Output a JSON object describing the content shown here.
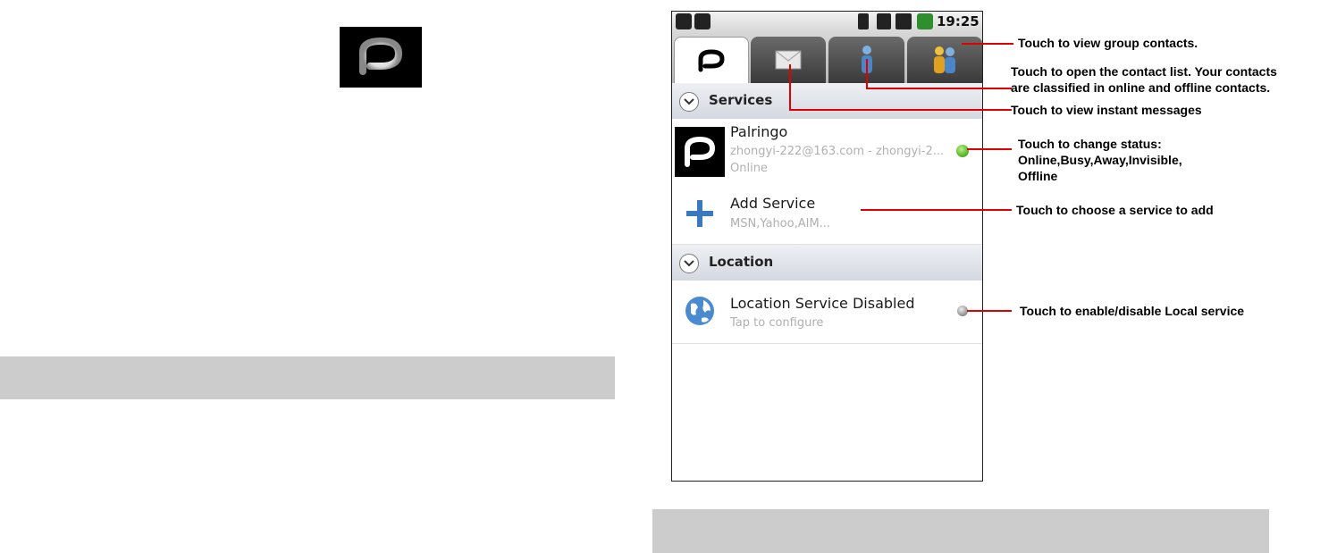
{
  "phone": {
    "status_bar": {
      "time": "19:25"
    },
    "tabs": [
      {
        "icon": "palringo-icon",
        "selected": true
      },
      {
        "icon": "envelope-icon"
      },
      {
        "icon": "person-icon"
      },
      {
        "icon": "group-icon"
      }
    ],
    "sections": {
      "services": {
        "title": "Services",
        "items": [
          {
            "name": "Palringo",
            "detail": "zhongyi-222@163.com - zhongyi-2...",
            "status": "Online",
            "status_color": "#5cb82a"
          },
          {
            "name": "Add Service",
            "detail": "MSN,Yahoo,AIM..."
          }
        ]
      },
      "location": {
        "title": "Location",
        "items": [
          {
            "name": "Location Service Disabled",
            "detail": "Tap to configure",
            "status_color": "#999999"
          }
        ]
      }
    }
  },
  "callouts": {
    "group_contacts": "Touch to view group contacts.",
    "contact_list_line1": "Touch to open the contact list. Your contacts",
    "contact_list_line2": "are classified in online and offline contacts.",
    "instant_messages": "Touch to view instant messages",
    "change_status_line1": "Touch to change status:",
    "change_status_line2": "Online,Busy,Away,Invisible,",
    "change_status_line3": "Offline",
    "add_service": "Touch to choose a service to add",
    "local_service": "Touch to enable/disable Local service"
  },
  "colors": {
    "callout_line": "#e00000",
    "section_header": "#dde1e8"
  }
}
